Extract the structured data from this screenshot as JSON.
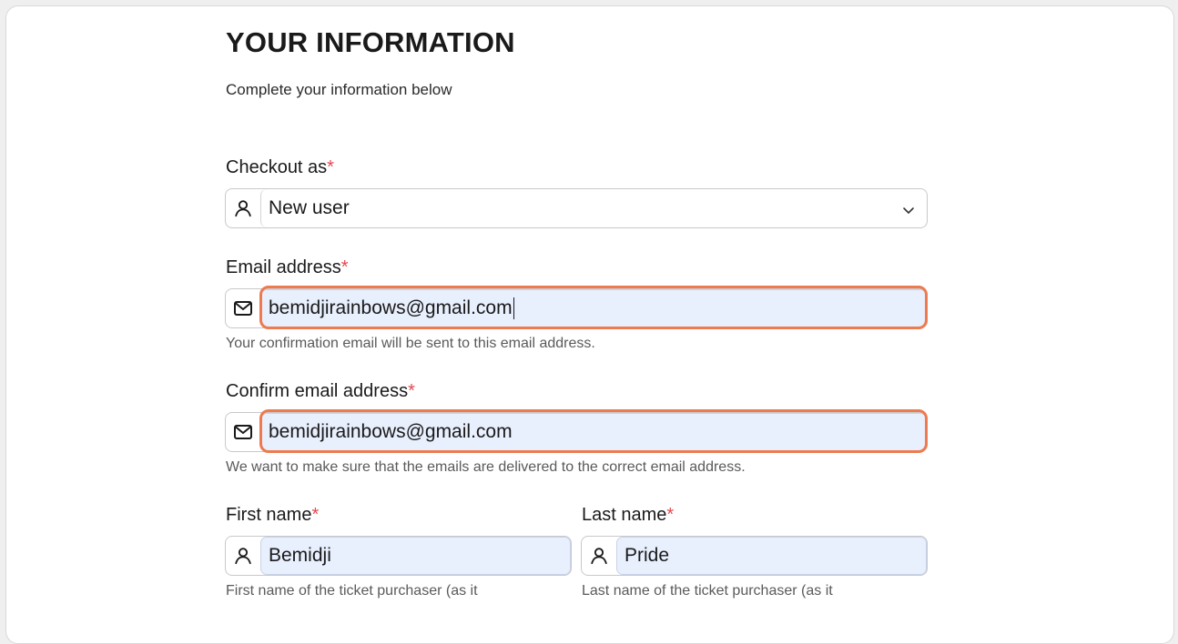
{
  "header": {
    "title": "YOUR INFORMATION",
    "subtitle": "Complete your information below"
  },
  "checkout": {
    "label": "Checkout as",
    "required_mark": "*",
    "selected": "New user",
    "icon": "user-icon"
  },
  "email": {
    "label": "Email address",
    "required_mark": "*",
    "value": "bemidjirainbows@gmail.com",
    "helper": "Your confirmation email will be sent to this email address.",
    "icon": "mail-icon"
  },
  "confirm_email": {
    "label": "Confirm email address",
    "required_mark": "*",
    "value": "bemidjirainbows@gmail.com",
    "helper": "We want to make sure that the emails are delivered to the correct email address.",
    "icon": "mail-icon"
  },
  "first_name": {
    "label": "First name",
    "required_mark": "*",
    "value": "Bemidji",
    "helper": "First name of the ticket purchaser (as it",
    "icon": "user-icon"
  },
  "last_name": {
    "label": "Last name",
    "required_mark": "*",
    "value": "Pride",
    "helper": "Last name of the ticket purchaser (as it",
    "icon": "user-icon"
  },
  "colors": {
    "highlight": "#ee7a4f",
    "autofill_bg": "#e8effd",
    "required": "#e5484d"
  }
}
